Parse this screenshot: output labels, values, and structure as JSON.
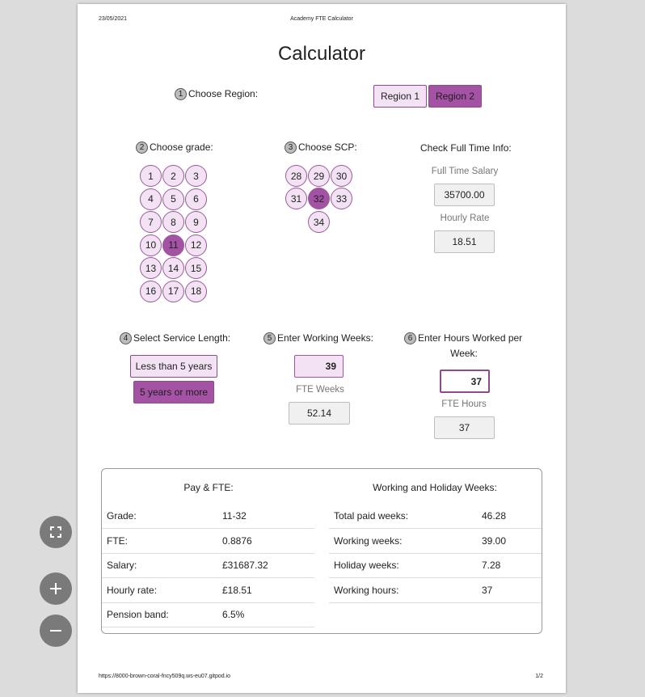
{
  "header": {
    "date": "23/05/2021",
    "title": "Academy FTE Calculator"
  },
  "footer": {
    "url": "https://8000-brown-coral-fncy509q.ws-eu07.gitpod.io",
    "page": "1/2"
  },
  "main_title": "Calculator",
  "steps": {
    "region": {
      "num": "1",
      "label": "Choose Region:"
    },
    "grade": {
      "num": "2",
      "label": "Choose grade:"
    },
    "scp": {
      "num": "3",
      "label": "Choose SCP:"
    },
    "service": {
      "num": "4",
      "label": "Select Service Length:"
    },
    "weeks": {
      "num": "5",
      "label": "Enter Working Weeks:"
    },
    "hours": {
      "num": "6",
      "label_line1": "Enter Hours Worked per",
      "label_line2": "Week:"
    }
  },
  "regions": [
    "Region 1",
    "Region 2"
  ],
  "selected_region": "Region 2",
  "grades": [
    "1",
    "2",
    "3",
    "4",
    "5",
    "6",
    "7",
    "8",
    "9",
    "10",
    "11",
    "12",
    "13",
    "14",
    "15",
    "16",
    "17",
    "18"
  ],
  "selected_grade": "11",
  "scps": [
    "28",
    "29",
    "30",
    "31",
    "32",
    "33",
    "34"
  ],
  "selected_scp": "32",
  "full_time_info": {
    "heading": "Check Full Time Info:",
    "salary_label": "Full Time Salary",
    "salary_value": "35700.00",
    "hourly_label": "Hourly Rate",
    "hourly_value": "18.51"
  },
  "service_options": [
    "Less than 5 years",
    "5 years or more"
  ],
  "selected_service": "5 years or more",
  "working_weeks": {
    "value": "39",
    "fte_label": "FTE Weeks",
    "fte_value": "52.14"
  },
  "hours_worked": {
    "value": "37",
    "fte_label": "FTE Hours",
    "fte_value": "37"
  },
  "summary": {
    "left_heading": "Pay & FTE:",
    "right_heading": "Working and Holiday Weeks:",
    "left_rows": [
      {
        "label": "Grade:",
        "value": "11-32"
      },
      {
        "label": "FTE:",
        "value": "0.8876"
      },
      {
        "label": "Salary:",
        "value": "£31687.32"
      },
      {
        "label": "Hourly rate:",
        "value": "£18.51"
      },
      {
        "label": "Pension band:",
        "value": "6.5%"
      }
    ],
    "right_rows": [
      {
        "label": "Total paid weeks:",
        "value": "46.28"
      },
      {
        "label": "Working weeks:",
        "value": "39.00"
      },
      {
        "label": "Holiday weeks:",
        "value": "7.28"
      },
      {
        "label": "Working hours:",
        "value": "37"
      }
    ]
  },
  "colors": {
    "accent": "#a452a4",
    "accent_light": "#f3e2f3",
    "border": "#8e4a8e"
  },
  "viewer_controls": [
    "fullscreen-icon",
    "zoom-in-icon",
    "zoom-out-icon"
  ]
}
